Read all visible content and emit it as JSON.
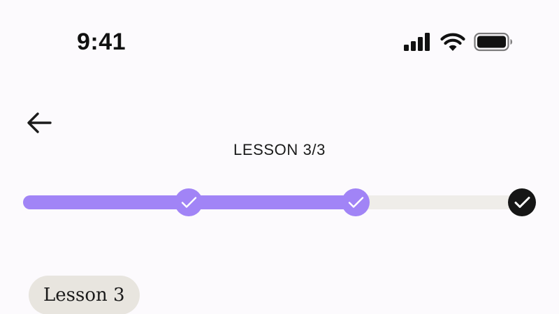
{
  "status_bar": {
    "time": "9:41",
    "icons": [
      "cellular-signal-icon",
      "wifi-icon",
      "battery-icon"
    ]
  },
  "header": {
    "back_icon": "arrow-left-icon",
    "title": "LESSON 3/3"
  },
  "progress": {
    "total_steps": 3,
    "current_step": 3,
    "completed_steps": [
      1,
      2,
      3
    ],
    "fill_fraction": 0.67,
    "colors": {
      "fill": "#A184F6",
      "track": "#EFEDE9",
      "completed_node": "#A184F6",
      "current_node": "#161616",
      "check": "#FFFFFF"
    }
  },
  "chip": {
    "label": "Lesson 3"
  },
  "colors": {
    "background": "#FCFAFD",
    "text": "#1B1B1B",
    "chip_bg": "#E8E5DF"
  }
}
